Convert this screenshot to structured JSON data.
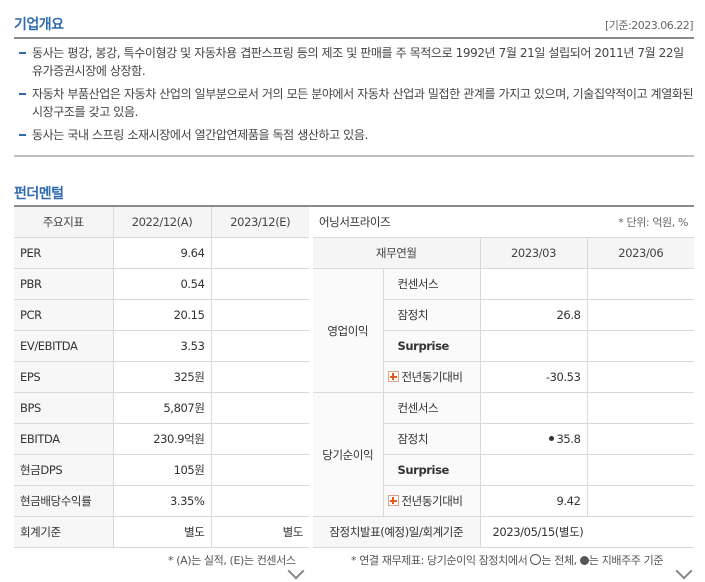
{
  "overview": {
    "title": "기업개요",
    "base_date": "[기준:2023.06.22]",
    "bullets": [
      "동사는 평강, 봉강, 특수이형강 및 자동차용 겹판스프링 등의 제조 및 판매를 주 목적으로 1992년 7월 21일 설립되어 2011년 7월 22일 유가증권시장에 상장함.",
      "자동차 부품산업은 자동차 산업의 일부분으로서 거의 모든 분야에서 자동차 산업과 밀접한 관계를 가지고 있으며, 기술집약적이고 계열화된 시장구조를 갖고 있음.",
      "동사는 국내 스프링 소재시장에서 열간압연제품을 독점 생산하고 있음."
    ]
  },
  "fundamental": {
    "title": "펀더멘털",
    "headers": [
      "주요지표",
      "2022/12(A)",
      "2023/12(E)"
    ],
    "rows": [
      {
        "label": "PER",
        "a": "9.64",
        "e": ""
      },
      {
        "label": "PBR",
        "a": "0.54",
        "e": ""
      },
      {
        "label": "PCR",
        "a": "20.15",
        "e": ""
      },
      {
        "label": "EV/EBITDA",
        "a": "3.53",
        "e": ""
      },
      {
        "label": "EPS",
        "a": "325원",
        "e": ""
      },
      {
        "label": "BPS",
        "a": "5,807원",
        "e": ""
      },
      {
        "label": "EBITDA",
        "a": "230.9억원",
        "e": ""
      },
      {
        "label": "현금DPS",
        "a": "105원",
        "e": ""
      },
      {
        "label": "현금배당수익률",
        "a": "3.35%",
        "e": ""
      },
      {
        "label": "회계기준",
        "a": "별도",
        "e": "별도"
      }
    ],
    "note": "* (A)는 실적, (E)는 컨센서스"
  },
  "earnings": {
    "title": "어닝서프라이즈",
    "unit": "* 단위: 억원, %",
    "headers": [
      "재무연월",
      "2023/03",
      "2023/06"
    ],
    "groups": [
      {
        "label": "영업이익",
        "rows": [
          {
            "label": "컨센서스",
            "q1": "",
            "q2": ""
          },
          {
            "label": "잠정치",
            "q1": "26.8",
            "q2": ""
          },
          {
            "label": "Surprise",
            "q1": "",
            "q2": ""
          },
          {
            "label": "전년동기대비",
            "q1": "-30.53",
            "q2": ""
          }
        ]
      },
      {
        "label": "당기순이익",
        "rows": [
          {
            "label": "컨센서스",
            "q1": "",
            "q2": ""
          },
          {
            "label": "잠정치",
            "q1": "35.8",
            "q2": ""
          },
          {
            "label": "Surprise",
            "q1": "",
            "q2": ""
          },
          {
            "label": "전년동기대비",
            "q1": "9.42",
            "q2": ""
          }
        ]
      }
    ],
    "footer_label": "잠정치발표(예정)일/회계기준",
    "footer_value": "2023/05/15(별도)",
    "note_a": "* 연결 재무제표: 당기순이익 잠정치에서",
    "note_b": "는 전체,",
    "note_c": "는 지배주주 기준"
  }
}
